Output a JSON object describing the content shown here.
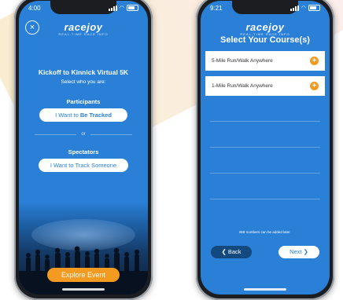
{
  "screen1": {
    "status_time": "4:00",
    "close_symbol": "×",
    "logo": "racejoy",
    "logo_sub": "REAL-TIME RACE INFO",
    "event_title": "Kickoff to Kinnick Virtual 5K",
    "select_prompt": "Select who you are:",
    "participants_heading": "Participants",
    "tracked_button_prefix": "I Want to ",
    "tracked_button_bold": "Be Tracked",
    "or_label": "or",
    "spectators_heading": "Spectators",
    "track_someone_button": "I Want to Track Someone",
    "explore_button": "Explore Event"
  },
  "screen2": {
    "status_time": "9:21",
    "logo": "racejoy",
    "logo_sub": "REAL-TIME RACE INFO",
    "heading": "Select Your Course(s)",
    "courses": [
      {
        "label": "5-Mile Run/Walk Anywhere",
        "action": "+"
      },
      {
        "label": "1-Mile Run/Walk Anywhere",
        "action": "+"
      }
    ],
    "bib_note": "BIB numbers can be added later.",
    "back_label": "❮ Back",
    "next_label": "Next ❯"
  },
  "colors": {
    "brand_blue": "#2a7fd6",
    "accent_orange": "#f39a21",
    "back_button": "#13497f"
  }
}
